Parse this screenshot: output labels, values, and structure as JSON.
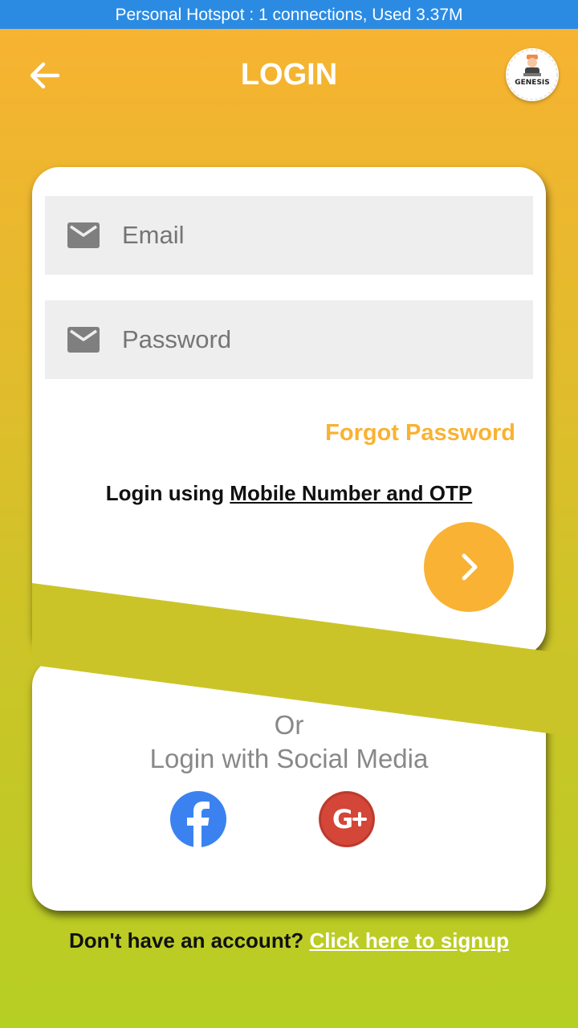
{
  "status_bar": {
    "text": "Personal Hotspot : 1 connections, Used 3.37M"
  },
  "header": {
    "title": "LOGIN",
    "back_icon": "arrow-left-icon",
    "logo_text": "GENESIS"
  },
  "login_form": {
    "email": {
      "placeholder": "Email",
      "value": "",
      "icon": "mail-icon"
    },
    "password": {
      "placeholder": "Password",
      "value": "",
      "icon": "mail-icon"
    },
    "forgot_label": "Forgot Password",
    "otp_prefix": "Login using ",
    "otp_link": "Mobile Number and OTP",
    "submit_icon": "chevron-right-icon"
  },
  "social": {
    "or_label": "Or",
    "title": "Login with Social Media",
    "providers": [
      "facebook-icon",
      "google-plus-icon"
    ]
  },
  "footer": {
    "prompt": "Don't have an account? ",
    "signup_link": "Click here to signup"
  },
  "colors": {
    "status_bar": "#2b8be3",
    "accent_orange": "#f9b233",
    "band_olive": "#cbc428",
    "gradient_bottom": "#b6cf24",
    "facebook": "#3b82f0",
    "google_plus": "#d44638"
  }
}
